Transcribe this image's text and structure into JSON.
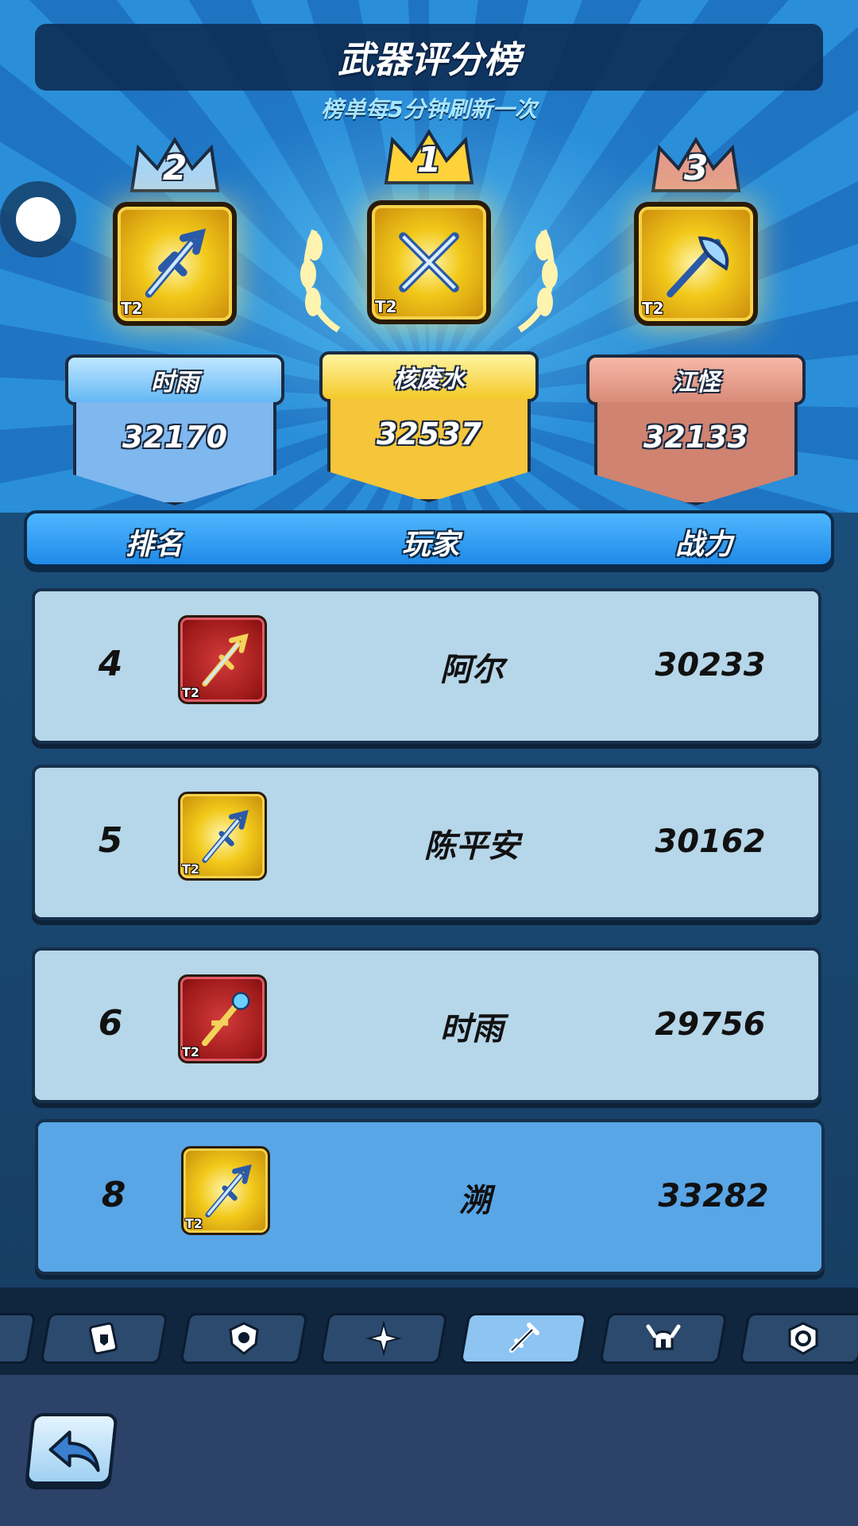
{
  "header": {
    "title": "武器评分榜",
    "subtitle": "榜单每5分钟刷新一次"
  },
  "podium": [
    {
      "rank": "1",
      "player": "核废水",
      "score": "32537",
      "tier": "T2",
      "weapon_icon": "crossed-blades-icon"
    },
    {
      "rank": "2",
      "player": "时雨",
      "score": "32170",
      "tier": "T2",
      "weapon_icon": "trident-sword-icon"
    },
    {
      "rank": "3",
      "player": "江怪",
      "score": "32133",
      "tier": "T2",
      "weapon_icon": "battle-axe-icon"
    }
  ],
  "list_header": {
    "rank_label": "排名",
    "player_label": "玩家",
    "power_label": "战力"
  },
  "rows": [
    {
      "rank": "4",
      "player": "阿尔",
      "power": "30233",
      "tier": "T2",
      "icon_style": "red",
      "weapon_icon": "trident-sword-icon"
    },
    {
      "rank": "5",
      "player": "陈平安",
      "power": "30162",
      "tier": "T2",
      "icon_style": "gold",
      "weapon_icon": "trident-sword-icon"
    },
    {
      "rank": "6",
      "player": "时雨",
      "power": "29756",
      "tier": "T2",
      "icon_style": "red",
      "weapon_icon": "magic-staff-icon"
    }
  ],
  "my_row": {
    "rank": "8",
    "player": "溯",
    "power": "33282",
    "tier": "T2",
    "icon_style": "gold",
    "weapon_icon": "trident-sword-icon"
  },
  "tabs": [
    {
      "icon": "card-shield-icon",
      "active": false
    },
    {
      "icon": "shield-emblem-icon",
      "active": false
    },
    {
      "icon": "sparkle-icon",
      "active": false
    },
    {
      "icon": "sword-icon",
      "active": true
    },
    {
      "icon": "horned-helmet-icon",
      "active": false
    },
    {
      "icon": "orb-badge-icon",
      "active": false
    }
  ],
  "colors": {
    "gold": "#f2c91a",
    "silver_blue": "#7fc0ff",
    "bronze": "#d98a78",
    "my_row": "#58a6e6",
    "row": "#b6d6e9"
  }
}
